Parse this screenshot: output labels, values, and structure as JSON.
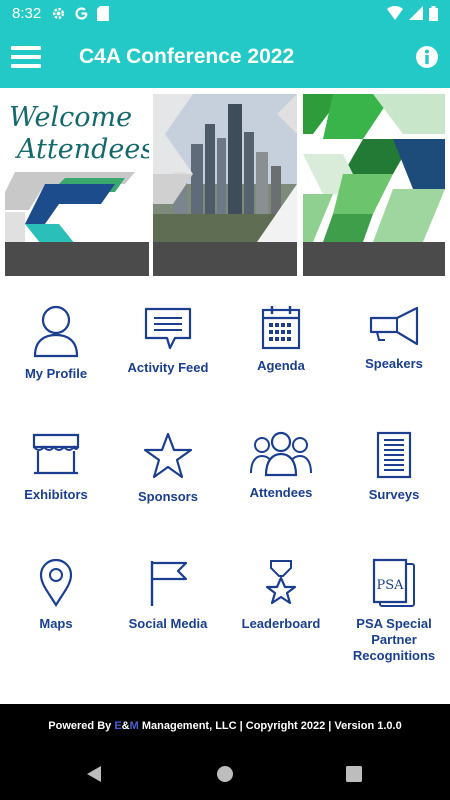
{
  "status_bar": {
    "time": "8:32"
  },
  "app_bar": {
    "title": "C4A Conference 2022"
  },
  "banner": {
    "welcome_line1": "Welcome",
    "welcome_line2": "Attendees"
  },
  "tiles": [
    {
      "label": "My Profile"
    },
    {
      "label": "Activity Feed"
    },
    {
      "label": "Agenda"
    },
    {
      "label": "Speakers"
    },
    {
      "label": "Exhibitors"
    },
    {
      "label": "Sponsors"
    },
    {
      "label": "Attendees"
    },
    {
      "label": "Surveys"
    },
    {
      "label": "Maps"
    },
    {
      "label": "Social Media"
    },
    {
      "label": "Leaderboard"
    },
    {
      "label": "PSA Special Partner Recognitions"
    }
  ],
  "psa_icon_text": "PSA",
  "footer": {
    "prefix": "Powered By ",
    "brand_e1": "E",
    "brand_amp": "&",
    "brand_m": "M",
    "suffix": " Management, LLC | Copyright 2022 | Version 1.0.0"
  },
  "colors": {
    "accent": "#23c9c6",
    "icon_blue": "#1b3f8e",
    "footer_bg": "#000000"
  }
}
